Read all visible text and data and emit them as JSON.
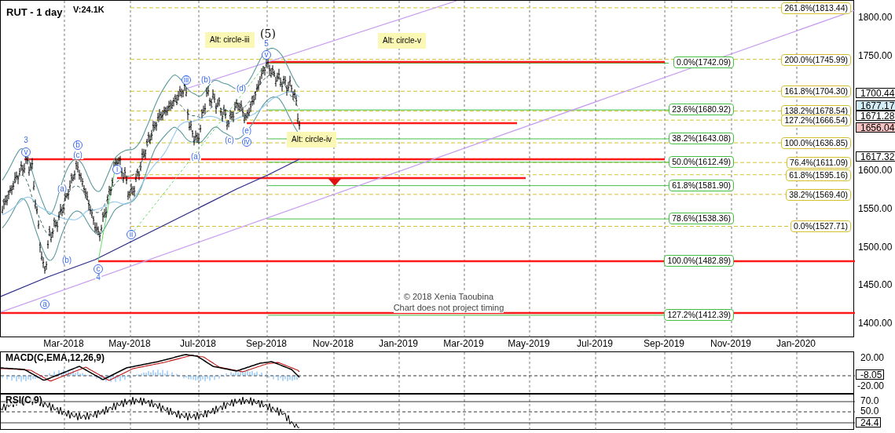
{
  "chart": {
    "title": "RUT - 1 day",
    "volume": "V:24.1K",
    "wave_labels": [
      {
        "text": "3",
        "circled": false,
        "kind": "minor"
      },
      {
        "text": "v",
        "circled": true,
        "kind": "minor"
      },
      {
        "text": "b",
        "circled": true,
        "kind": "minor"
      },
      {
        "text": "(c)",
        "circled": false,
        "kind": "minor"
      },
      {
        "text": "(a)",
        "circled": false,
        "kind": "minor"
      },
      {
        "text": "(b)",
        "circled": false,
        "kind": "minor"
      },
      {
        "text": "a",
        "circled": true,
        "kind": "minor"
      },
      {
        "text": "c",
        "circled": true,
        "kind": "minor"
      },
      {
        "text": "4",
        "circled": false,
        "kind": "minor"
      },
      {
        "text": "i",
        "circled": true,
        "kind": "minor"
      },
      {
        "text": "ii",
        "circled": true,
        "kind": "minor"
      },
      {
        "text": "(a)",
        "circled": false,
        "kind": "minor"
      },
      {
        "text": "iii",
        "circled": true,
        "kind": "minor"
      },
      {
        "text": "(b)",
        "circled": false,
        "kind": "minor"
      },
      {
        "text": "(d)",
        "circled": false,
        "kind": "minor"
      },
      {
        "text": "(c)",
        "circled": false,
        "kind": "minor"
      },
      {
        "text": "(e)",
        "circled": false,
        "kind": "minor"
      },
      {
        "text": "iv",
        "circled": true,
        "kind": "minor"
      },
      {
        "text": "(5)",
        "circled": false,
        "kind": "primary"
      },
      {
        "text": "5",
        "circled": false,
        "kind": "minor"
      },
      {
        "text": "v",
        "circled": true,
        "kind": "minor"
      }
    ],
    "notes": [
      "Alt: circle-iii",
      "Alt: circle-v",
      "Alt: circle-iv"
    ],
    "copyright": [
      "© 2018 Xenia Taoubina",
      "Chart does not project timing"
    ],
    "retracement_labels": [
      "0.0%(1742.09)",
      "23.6%(1680.92)",
      "38.2%(1643.08)",
      "50.0%(1612.49)",
      "61.8%(1581.90)",
      "78.6%(1538.36)",
      "100.0%(1482.89)",
      "127.2%(1412.39)"
    ],
    "extension_labels": [
      "261.8%(1813.44)",
      "200.0%(1745.99)",
      "161.8%(1704.30)",
      "138.2%(1678.54)",
      "127.2%(1666.54)",
      "100.0%(1636.85)",
      "76.4%(1611.09)",
      "61.8%(1595.16)",
      "38.2%(1569.40)",
      "0.0%(1527.71)"
    ],
    "price_axis": [
      "1800.00",
      "1750.00",
      "1600.00",
      "1550.00",
      "1500.00",
      "1450.00",
      "1400.00"
    ],
    "price_badges": [
      {
        "text": "1700.44",
        "kind": "level"
      },
      {
        "text": "1677.17",
        "kind": "average"
      },
      {
        "text": "1671.28",
        "kind": "level"
      },
      {
        "text": "1656.04",
        "kind": "last"
      },
      {
        "text": "1617.32",
        "kind": "level"
      }
    ]
  },
  "date_axis": [
    "Mar-2018",
    "May-2018",
    "Jul-2018",
    "Sep-2018",
    "Nov-2018",
    "Jan-2019",
    "Mar-2019",
    "May-2019",
    "Jul-2019",
    "Sep-2019",
    "Nov-2019",
    "Jan-2020"
  ],
  "macd": {
    "title": "MACD(C,EMA,12,26,9)",
    "axis": [
      "20.00",
      "-20.00"
    ],
    "badge": "-8.05"
  },
  "rsi": {
    "title": "RSI(C,9)",
    "axis": [
      "70.0",
      "50.0"
    ],
    "badge": "24.4"
  }
}
